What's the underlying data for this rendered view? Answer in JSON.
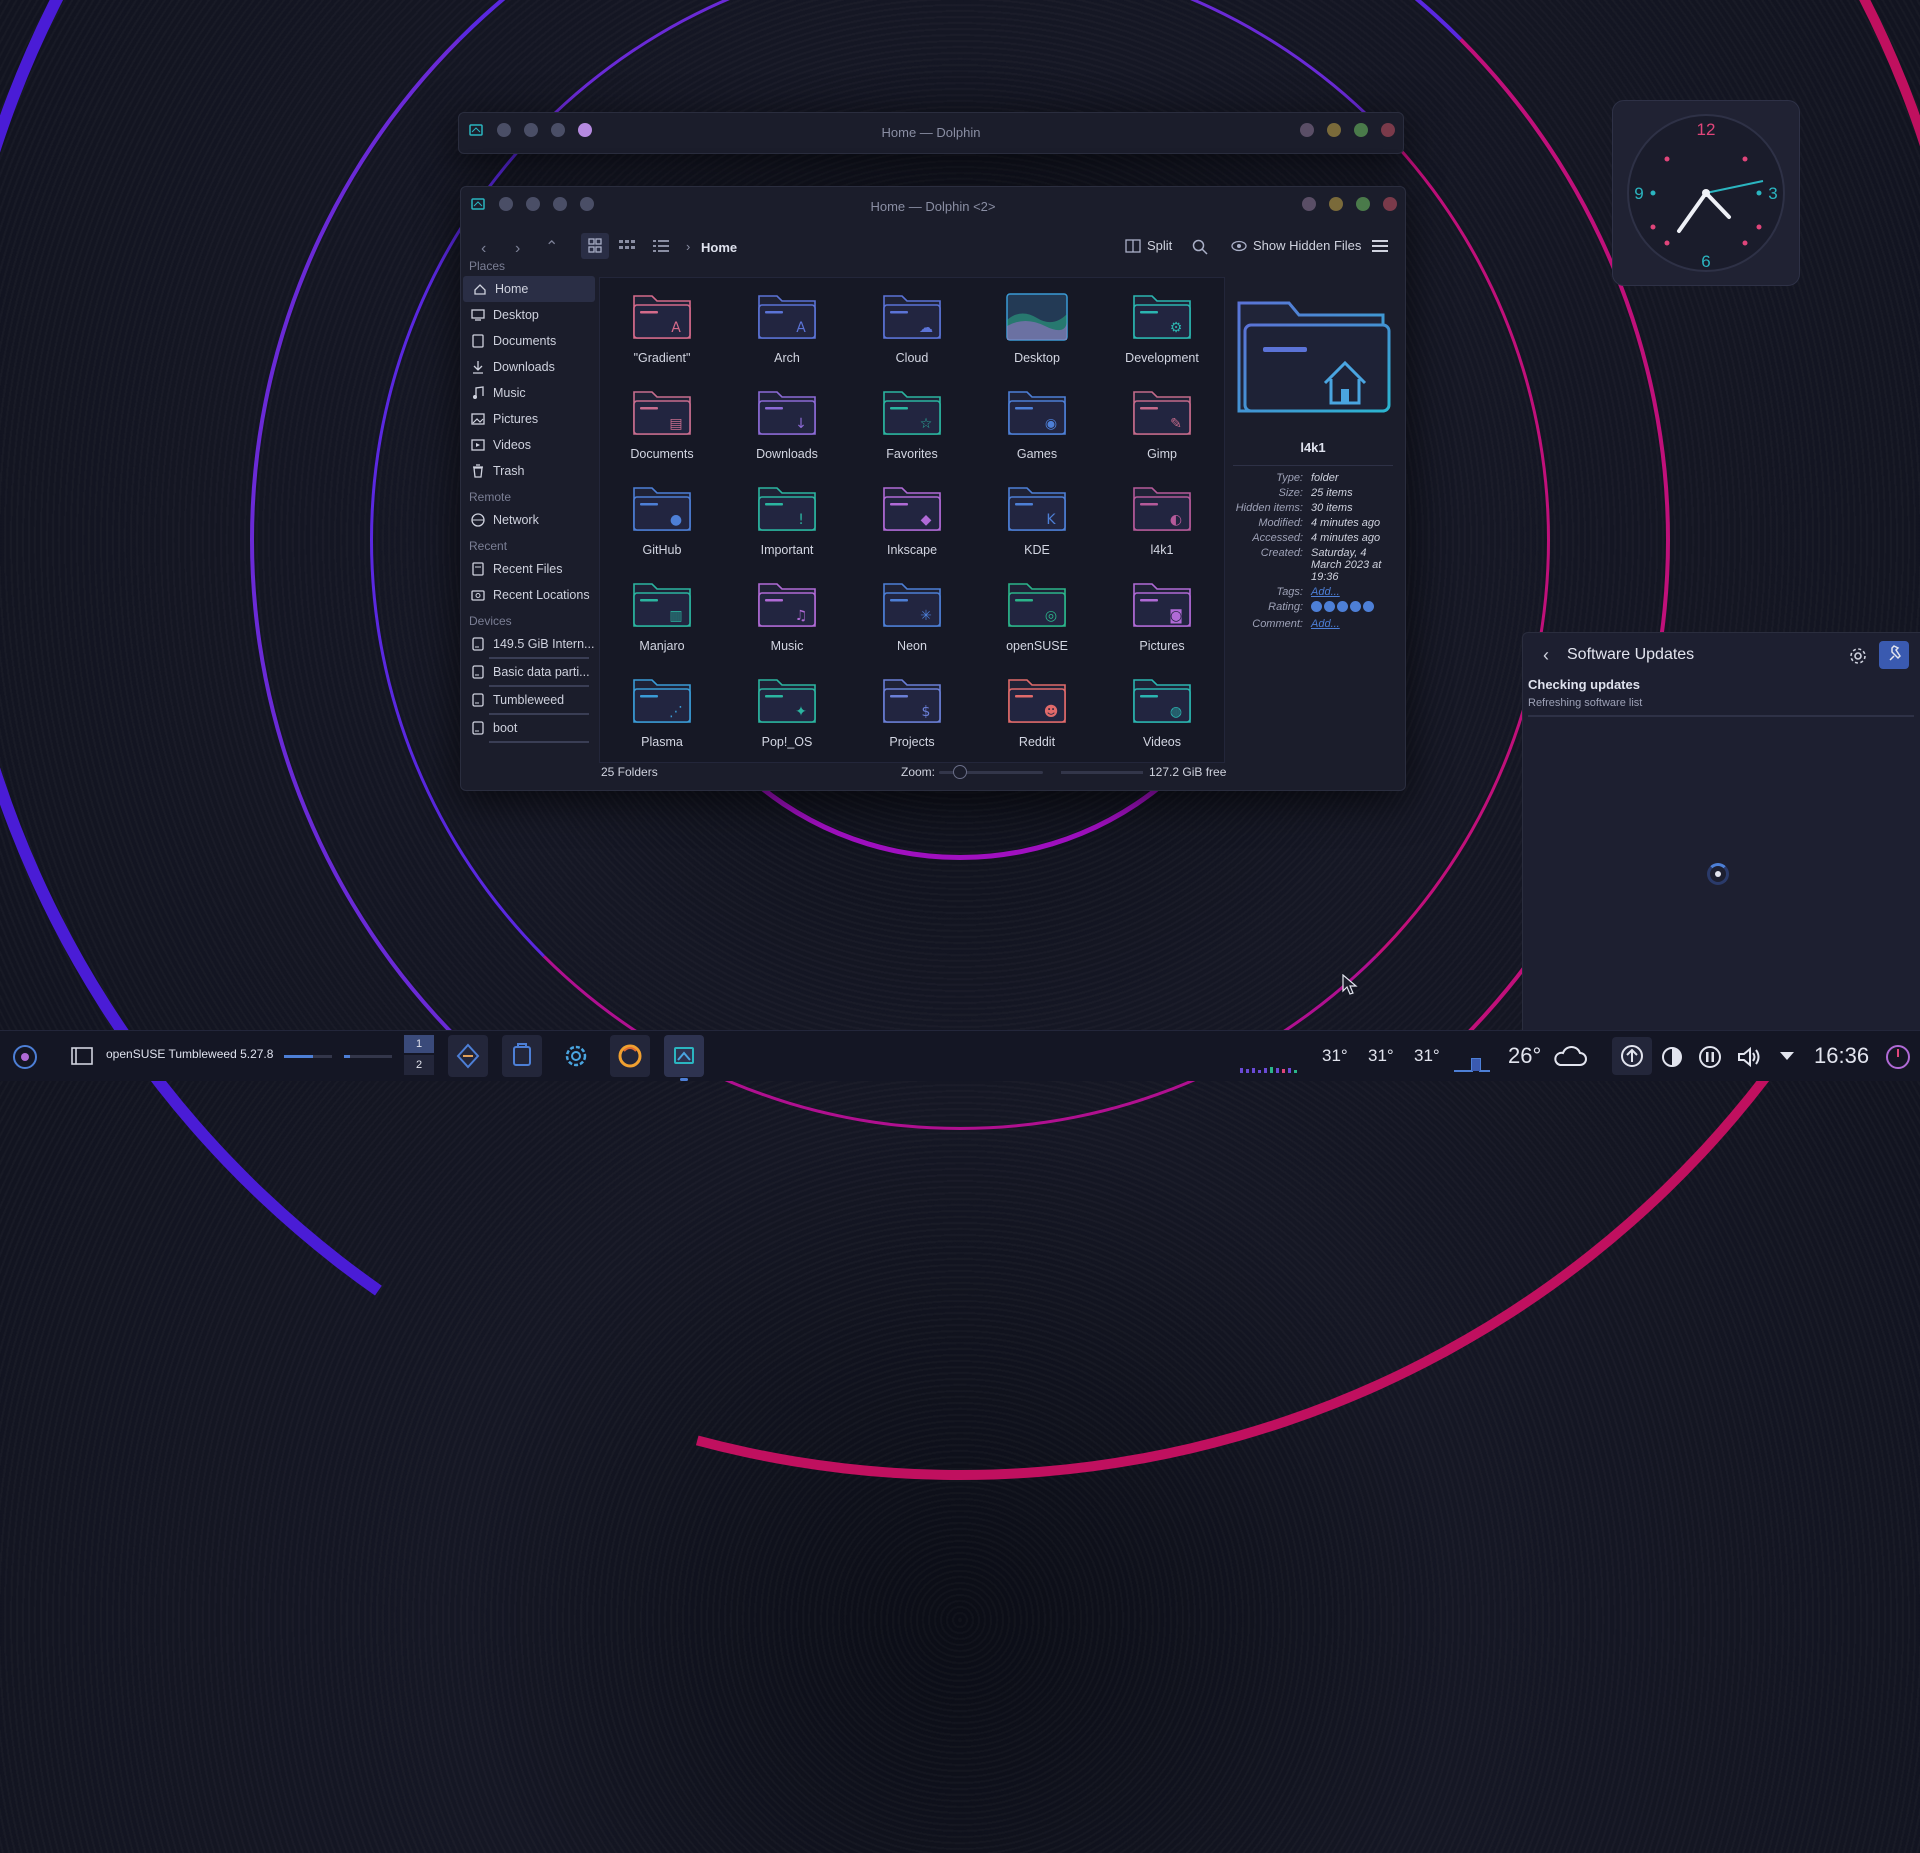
{
  "window_back": {
    "title": "Home — Dolphin"
  },
  "window_front": {
    "title": "Home — Dolphin <2>",
    "breadcrumb": "Home",
    "split_label": "Split",
    "hidden_label": "Show Hidden Files",
    "status_count": "25 Folders",
    "zoom_label": "Zoom:",
    "free_space": "127.2 GiB free"
  },
  "sidebar": {
    "places_label": "Places",
    "places": [
      {
        "label": "Home",
        "icon": "home-icon"
      },
      {
        "label": "Desktop",
        "icon": "desktop-icon"
      },
      {
        "label": "Documents",
        "icon": "documents-icon"
      },
      {
        "label": "Downloads",
        "icon": "downloads-icon"
      },
      {
        "label": "Music",
        "icon": "music-icon"
      },
      {
        "label": "Pictures",
        "icon": "pictures-icon"
      },
      {
        "label": "Videos",
        "icon": "videos-icon"
      },
      {
        "label": "Trash",
        "icon": "trash-icon"
      }
    ],
    "remote_label": "Remote",
    "remote": [
      {
        "label": "Network",
        "icon": "network-icon"
      }
    ],
    "recent_label": "Recent",
    "recent": [
      {
        "label": "Recent Files",
        "icon": "recent-files-icon"
      },
      {
        "label": "Recent Locations",
        "icon": "recent-locations-icon"
      }
    ],
    "devices_label": "Devices",
    "devices": [
      {
        "label": "149.5 GiB Intern...",
        "icon": "drive-icon"
      },
      {
        "label": "Basic data parti...",
        "icon": "drive-icon"
      },
      {
        "label": "Tumbleweed",
        "icon": "drive-icon"
      },
      {
        "label": "boot",
        "icon": "drive-icon"
      }
    ]
  },
  "folders": [
    {
      "label": "\"Gradient\"",
      "color": "#d46a8a",
      "emblem": "A"
    },
    {
      "label": "Arch",
      "color": "#5b73d6",
      "emblem": "A"
    },
    {
      "label": "Cloud",
      "color": "#5b73d6",
      "emblem": "☁"
    },
    {
      "label": "Desktop",
      "color": "#3a9bd6",
      "emblem": ""
    },
    {
      "label": "Development",
      "color": "#2bb5b0",
      "emblem": "⚙"
    },
    {
      "label": "Documents",
      "color": "#c76d8e",
      "emblem": "▤"
    },
    {
      "label": "Downloads",
      "color": "#8c6ad6",
      "emblem": "↓"
    },
    {
      "label": "Favorites",
      "color": "#2bb5a0",
      "emblem": "☆"
    },
    {
      "label": "Games",
      "color": "#4d7fd6",
      "emblem": "◉"
    },
    {
      "label": "Gimp",
      "color": "#c46a8a",
      "emblem": "✎"
    },
    {
      "label": "GitHub",
      "color": "#4d7fd6",
      "emblem": "●"
    },
    {
      "label": "Important",
      "color": "#2bb5a0",
      "emblem": "!"
    },
    {
      "label": "Inkscape",
      "color": "#b06ad6",
      "emblem": "◆"
    },
    {
      "label": "KDE",
      "color": "#4d7fd6",
      "emblem": "K"
    },
    {
      "label": "l4k1",
      "color": "#b55a9a",
      "emblem": "◐"
    },
    {
      "label": "Manjaro",
      "color": "#2bb5a0",
      "emblem": "▥"
    },
    {
      "label": "Music",
      "color": "#b06ad6",
      "emblem": "♫"
    },
    {
      "label": "Neon",
      "color": "#4d7fd6",
      "emblem": "✳"
    },
    {
      "label": "openSUSE",
      "color": "#2bb58a",
      "emblem": "◎"
    },
    {
      "label": "Pictures",
      "color": "#b06ad6",
      "emblem": "◙"
    },
    {
      "label": "Plasma",
      "color": "#3a9bd6",
      "emblem": "⋰"
    },
    {
      "label": "Pop!_OS",
      "color": "#2bb5a0",
      "emblem": "✦"
    },
    {
      "label": "Projects",
      "color": "#6a7fd6",
      "emblem": "$"
    },
    {
      "label": "Reddit",
      "color": "#e06a6a",
      "emblem": "☻"
    },
    {
      "label": "Videos",
      "color": "#2bb5b0",
      "emblem": "◍"
    }
  ],
  "info_panel": {
    "name": "l4k1",
    "rows": [
      {
        "k": "Type:",
        "v": "folder"
      },
      {
        "k": "Size:",
        "v": "25 items"
      },
      {
        "k": "Hidden items:",
        "v": "30 items"
      },
      {
        "k": "Modified:",
        "v": "4 minutes ago"
      },
      {
        "k": "Accessed:",
        "v": "4 minutes ago"
      },
      {
        "k": "Created:",
        "v": "Saturday, 4 March 2023 at 19:36"
      },
      {
        "k": "Tags:",
        "v": "Add..."
      },
      {
        "k": "Rating:",
        "v": ""
      },
      {
        "k": "Comment:",
        "v": "Add..."
      }
    ],
    "rating": 0
  },
  "software_updates": {
    "title": "Software Updates",
    "status": "Checking updates",
    "substatus": "Refreshing software list"
  },
  "clock": {
    "n12": "12",
    "n3": "3",
    "n6": "6",
    "n9": "9"
  },
  "taskbar": {
    "window_title": "openSUSE Tumbleweed 5.27.8",
    "desktop_1": "1",
    "desktop_2": "2",
    "temp_1": "31°",
    "temp_2": "31°",
    "temp_3": "31°",
    "weather_temp": "26°",
    "time": "16:36"
  },
  "colors": {
    "accent": "#4d7fd6",
    "ring_blue": "#5a1fd6",
    "ring_pink": "#c0105f"
  }
}
